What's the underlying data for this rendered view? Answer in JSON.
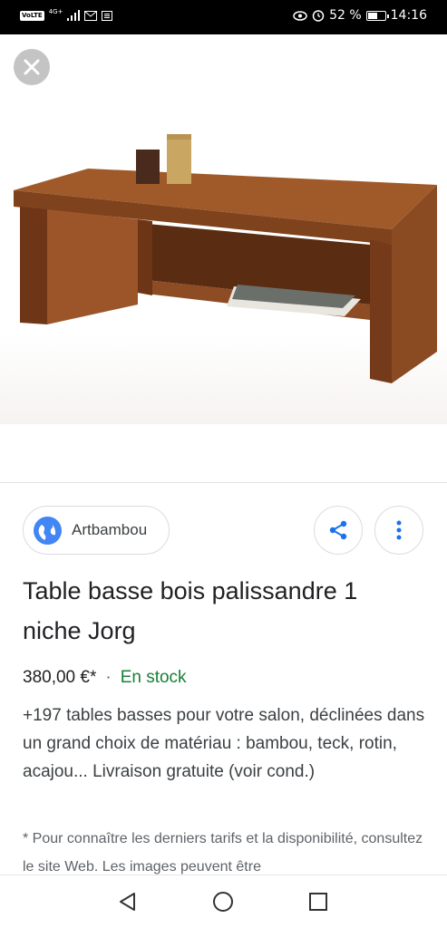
{
  "status_bar": {
    "volte": "VoLTE",
    "network": "4G+",
    "battery_percent": "52 %",
    "battery_level": 0.52,
    "time": "14:16",
    "icons": [
      "signal-icon",
      "mail-icon",
      "news-icon",
      "eye-icon",
      "alarm-icon",
      "battery-icon"
    ]
  },
  "viewer": {
    "close_icon": "close-icon",
    "image_subject": "product-photo"
  },
  "source": {
    "name": "Artbambou",
    "icon": "globe-icon"
  },
  "actions": {
    "share_icon": "share-icon",
    "more_icon": "more-vert-icon"
  },
  "product": {
    "title": "Table basse bois palissandre 1 niche Jorg",
    "price": "380,00 €*",
    "separator": "·",
    "availability": "En stock",
    "description": "+197 tables basses pour votre salon, déclinées dans un grand choix de matériau : bambou, teck, rotin, acajou... Livraison gratuite (voir cond.)",
    "disclaimer": "* Pour connaître les derniers tarifs et la disponibilité, consultez le site Web. Les images peuvent être"
  },
  "colors": {
    "in_stock": "#188038",
    "accent": "#4285f4"
  },
  "nav": {
    "icons": [
      "back-icon",
      "home-icon",
      "recents-icon"
    ]
  }
}
